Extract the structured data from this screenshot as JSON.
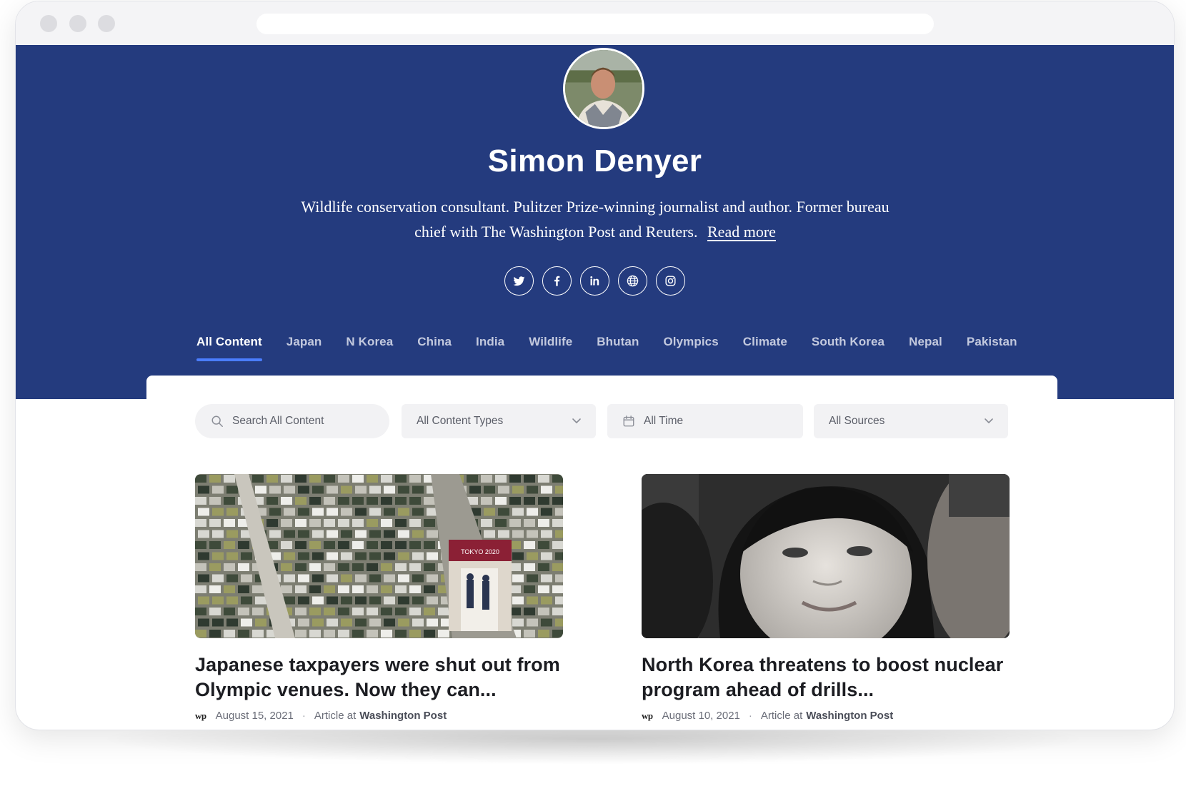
{
  "profile": {
    "name": "Simon Denyer",
    "bio": "Wildlife conservation consultant. Pulitzer Prize-winning journalist and author. Former bureau chief with The Washington Post and Reuters.",
    "read_more": "Read more"
  },
  "socials": [
    {
      "icon": "twitter-icon"
    },
    {
      "icon": "facebook-icon"
    },
    {
      "icon": "linkedin-icon"
    },
    {
      "icon": "globe-icon"
    },
    {
      "icon": "instagram-icon"
    }
  ],
  "tabs": [
    {
      "label": "All Content",
      "active": true
    },
    {
      "label": "Japan"
    },
    {
      "label": "N Korea"
    },
    {
      "label": "China"
    },
    {
      "label": "India"
    },
    {
      "label": "Wildlife"
    },
    {
      "label": "Bhutan"
    },
    {
      "label": "Olympics"
    },
    {
      "label": "Climate"
    },
    {
      "label": "South Korea"
    },
    {
      "label": "Nepal"
    },
    {
      "label": "Pakistan"
    }
  ],
  "filters": {
    "search_placeholder": "Search All Content",
    "content_types": "All Content Types",
    "time": "All Time",
    "sources": "All Sources"
  },
  "articles": [
    {
      "headline": "Japanese taxpayers were shut out from Olympic venues. Now they can...",
      "source_logo": "wp",
      "date": "August 15, 2021",
      "type_prefix": "Article at",
      "source": "Washington Post",
      "image_text": "TOKYO 2020"
    },
    {
      "headline": "North Korea threatens to boost nuclear program ahead of drills...",
      "source_logo": "wp",
      "date": "August 10, 2021",
      "type_prefix": "Article at",
      "source": "Washington Post"
    }
  ],
  "colors": {
    "hero_bg": "#243b7e",
    "tab_underline": "#4a7dff",
    "filter_bg": "#f2f2f4"
  }
}
